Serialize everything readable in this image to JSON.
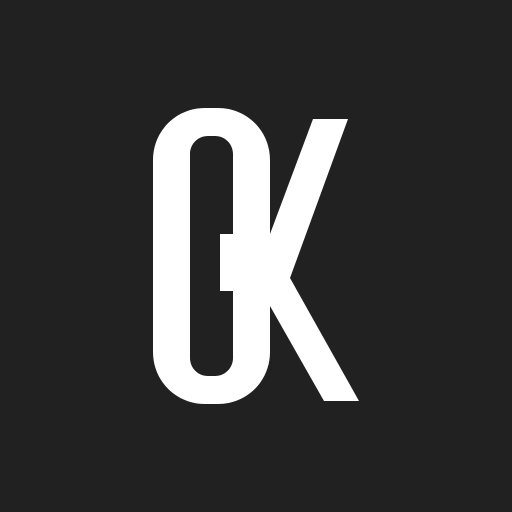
{
  "logo": {
    "monogram": "GK",
    "background_color": "#212121",
    "glyph_color": "#ffffff"
  }
}
